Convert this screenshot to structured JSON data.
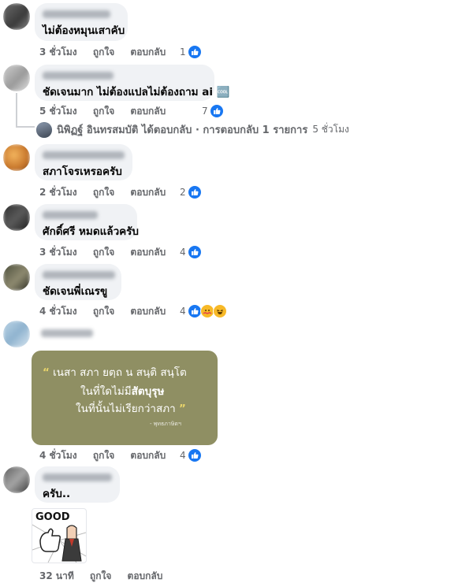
{
  "labels": {
    "like": "ถูกใจ",
    "reply": "ตอบกลับ"
  },
  "comments": [
    {
      "text": "ไม่ต้องหมุนเสาคับ",
      "time": "3 ชั่วโมง",
      "reactions": "1"
    },
    {
      "text": "ชัดเจนมาก ไม่ต้องแปลไม่ต้องถาม ai 🆒",
      "time": "5 ชั่วโมง",
      "reactions": "7"
    },
    {
      "text": "สภาโจรเหรอครับ",
      "time": "2 ชั่วโมง",
      "reactions": "2"
    },
    {
      "text": "ศักดิ์ศรี หมดแล้วครับ",
      "time": "3 ชั่วโมง",
      "reactions": "4"
    },
    {
      "text": "ชัดเจนพี่เณรขู",
      "time": "4 ชั่วโมง",
      "reactions": "4"
    },
    {
      "text": "",
      "time": "4 ชั่วโมง",
      "reactions": "4"
    },
    {
      "text": "ครับ..",
      "time": "32 นาที",
      "reactions": ""
    }
  ],
  "reply_summary": {
    "text": "นิพิฏฐ์ อินทรสมบัติ ได้ตอบกลับ · การตอบกลับ 1 รายการ",
    "time": "5 ชั่วโมง"
  },
  "quote_image": {
    "line1": "เนสา สภา ยตฺถ น สนฺติ สนฺโต",
    "line2a": "ในที่ใดไม่มี",
    "line2b": "สัตบุรุษ",
    "line3": "ในที่นั้นไม่เรียกว่าสภา",
    "attribution": "- พุทธภาษิตฯ"
  },
  "sticker_text": "GOOD",
  "colors": {
    "bubble": "#f0f2f5",
    "like_blue": "#1877f2",
    "meta_gray": "#65676b",
    "quote_bg": "#8f8f63"
  }
}
